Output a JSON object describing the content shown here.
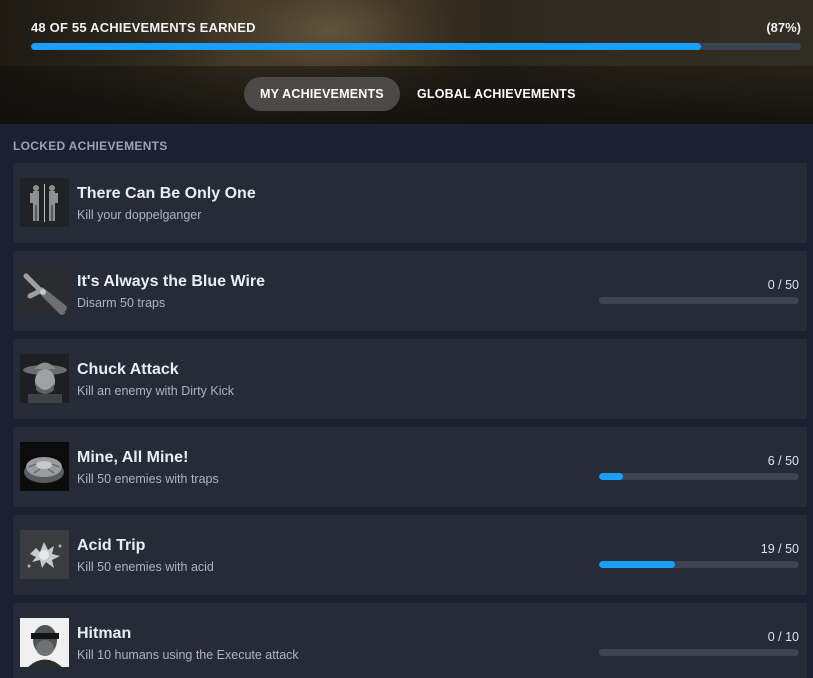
{
  "summary": {
    "label": "48 OF 55 ACHIEVEMENTS EARNED",
    "percent_text": "(87%)",
    "earned": 48,
    "total": 55,
    "progress_fraction": 0.87
  },
  "tabs": [
    {
      "label": "MY ACHIEVEMENTS",
      "active": true
    },
    {
      "label": "GLOBAL ACHIEVEMENTS",
      "active": false
    }
  ],
  "section": {
    "title": "LOCKED ACHIEVEMENTS"
  },
  "colors": {
    "accent": "#1a9fff",
    "card": "#262b38",
    "background": "#1b2130"
  },
  "achievements": [
    {
      "title": "There Can Be Only One",
      "description": "Kill your doppelganger",
      "icon": "doppelganger-icon"
    },
    {
      "title": "It's Always the Blue Wire",
      "description": "Disarm 50 traps",
      "icon": "wire-cutters-icon",
      "count_text": "0 / 50",
      "progress_fraction": 0.0
    },
    {
      "title": "Chuck Attack",
      "description": "Kill an enemy with Dirty Kick",
      "icon": "cowboy-portrait-icon"
    },
    {
      "title": "Mine, All Mine!",
      "description": "Kill 50 enemies with traps",
      "icon": "landmine-icon",
      "count_text": "6 / 50",
      "progress_fraction": 0.12
    },
    {
      "title": "Acid Trip",
      "description": "Kill 50 enemies with acid",
      "icon": "acid-splash-icon",
      "count_text": "19 / 50",
      "progress_fraction": 0.38
    },
    {
      "title": "Hitman",
      "description": "Kill 10 humans using the Execute attack",
      "icon": "hitman-portrait-icon",
      "count_text": "0 / 10",
      "progress_fraction": 0.0
    }
  ]
}
